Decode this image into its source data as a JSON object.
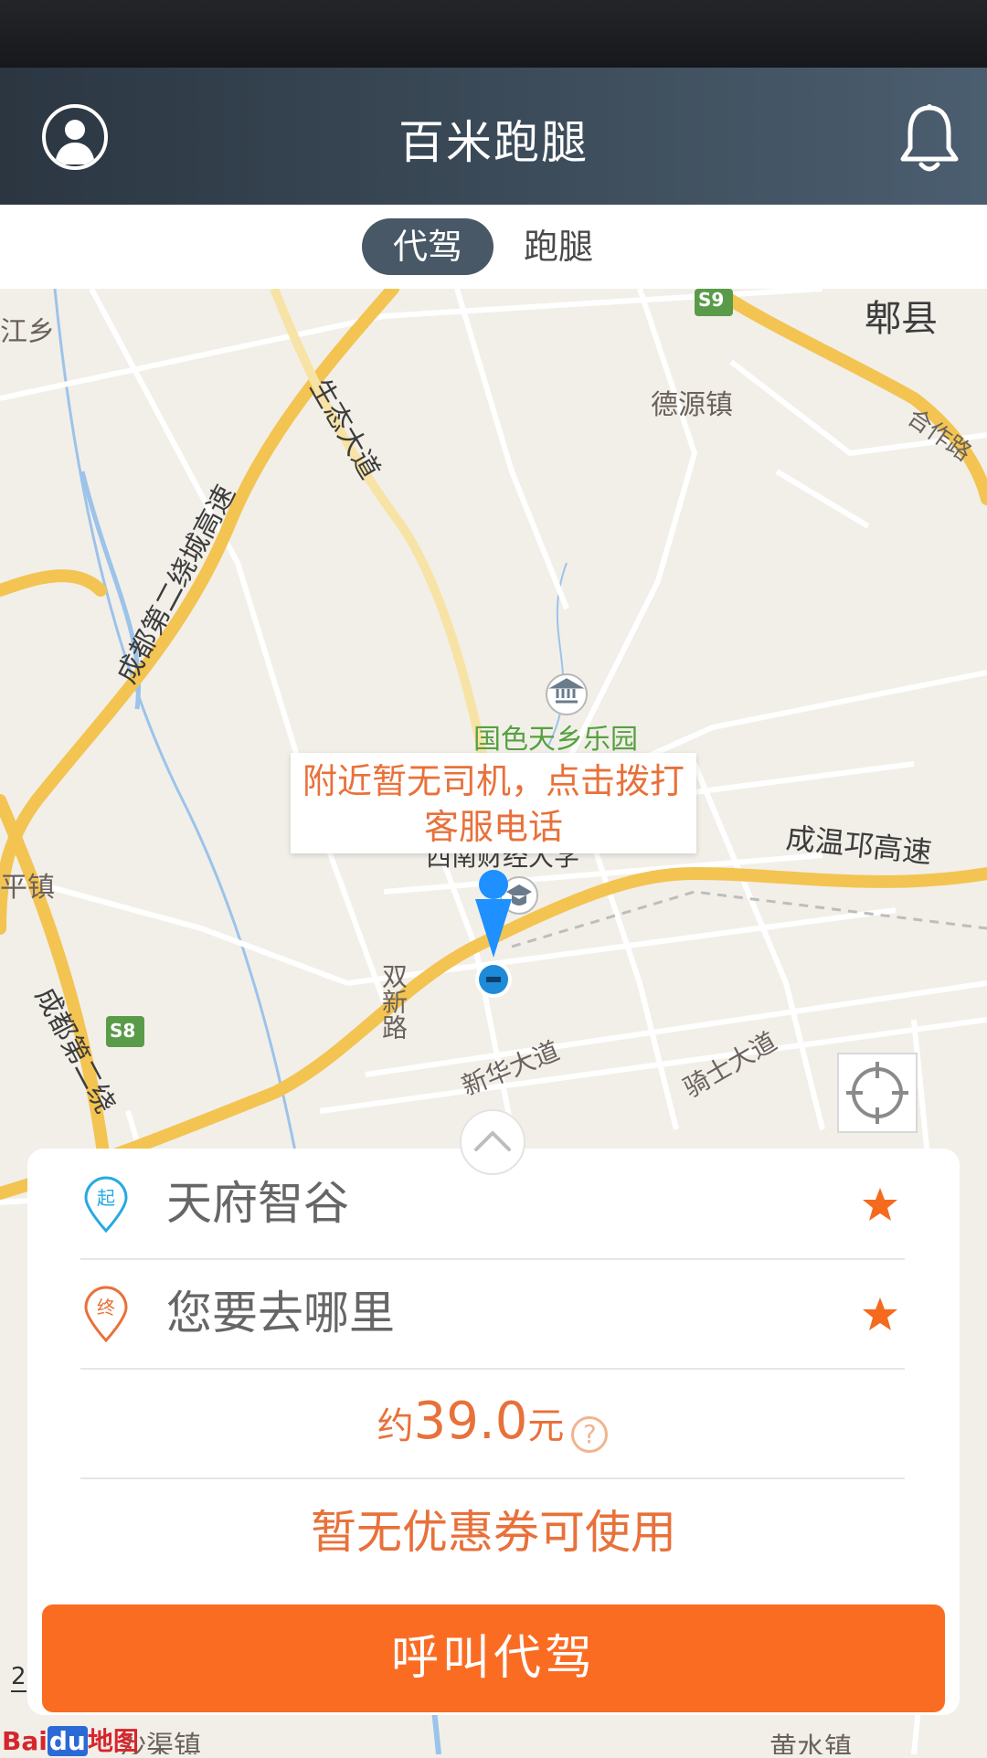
{
  "header": {
    "title": "百米跑腿"
  },
  "tabs": [
    {
      "label": "代驾",
      "active": true
    },
    {
      "label": "跑腿",
      "active": false
    }
  ],
  "map": {
    "labels": {
      "jiangxiang": "江乡",
      "pixian": "郫县",
      "deyuan": "德源镇",
      "hezuo": "合作路",
      "shengtai": "生态大道",
      "ring": "成都第二绕城高速",
      "guose": "国色天乡乐园",
      "chengwen": "成温邛高速",
      "pingzhen": "平镇",
      "shuangxin": "双新路",
      "xinhua": "新华大道",
      "qishi": "骑士大道",
      "ring2": "成都第二绕",
      "university": "西南财经大学",
      "shaqu": "沙渠镇",
      "huangshui": "黄水镇",
      "s9": "S9",
      "s8": "S8"
    },
    "callout": "附近暂无司机，点击拨打客服电话",
    "scale_label": "2",
    "logo_bai": "Bai",
    "logo_du": "du",
    "logo_map": "地图"
  },
  "panel": {
    "start_badge": "起",
    "end_badge": "终",
    "start_value": "天府智谷",
    "end_placeholder": "您要去哪里",
    "price_prefix": "约",
    "price_value": "39.0",
    "price_unit": "元",
    "help_symbol": "?",
    "coupon": "暂无优惠券可使用",
    "call_button": "呼叫代驾"
  },
  "colors": {
    "accent": "#fb6c23",
    "text_orange": "#e8713a",
    "nav_dark": "#2b3641",
    "start_pin": "#27a9e1",
    "end_pin": "#e8713a"
  }
}
